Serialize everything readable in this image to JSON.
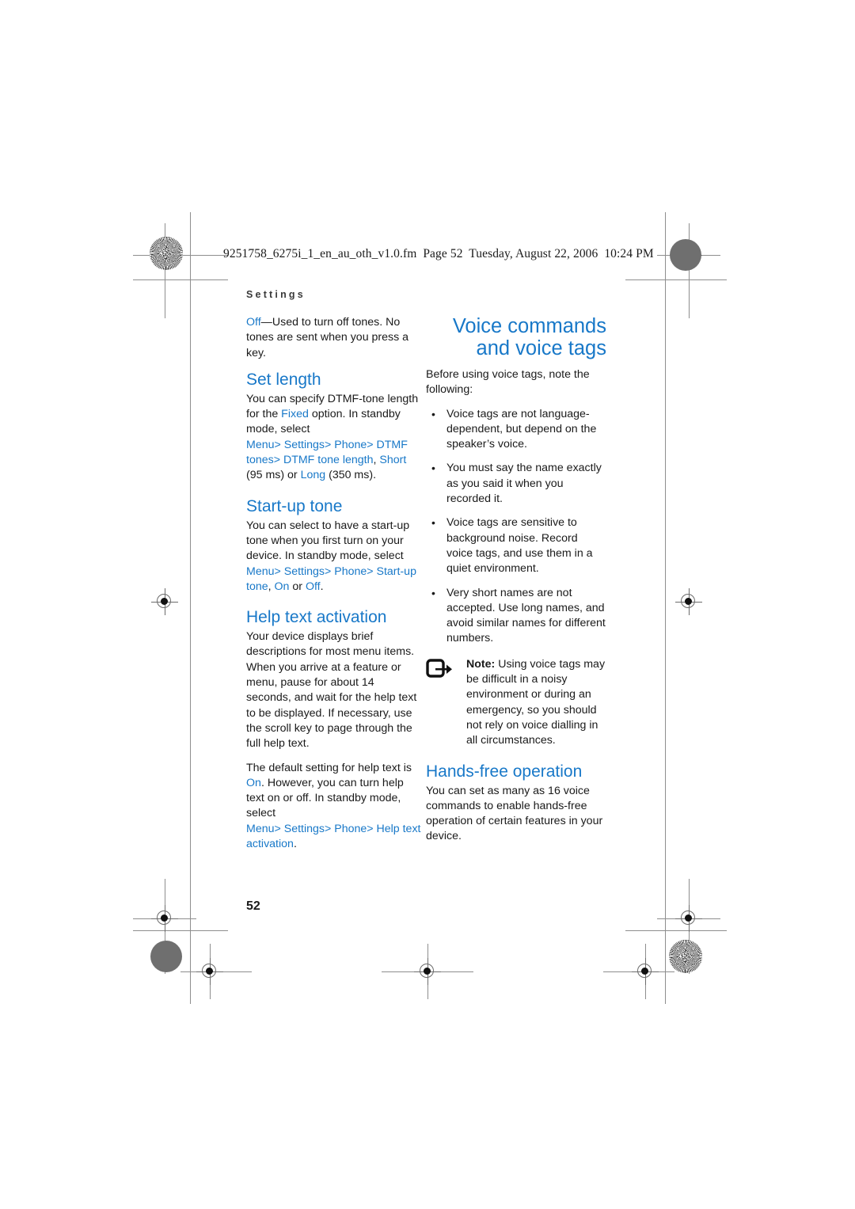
{
  "page": {
    "file_stamp": "9251758_6275i_1_en_au_oth_v1.0.fm  Page 52  Tuesday, August 22, 2006  10:24 PM",
    "running_head": "Settings",
    "page_number": "52",
    "accent_blue": "#1878c8",
    "text_color": "#1a1a1a"
  },
  "left_column": {
    "intro": {
      "term": "Off",
      "text": "—Used to turn off tones. No tones are sent when you press a key."
    },
    "set_length": {
      "heading": "Set length",
      "p1_a": "You can specify DTMF-tone length for the ",
      "p1_fixed": "Fixed",
      "p1_b": " option. In standby mode, select ",
      "path": [
        "Menu",
        "Settings",
        "Phone",
        "DTMF tones",
        "DTMF tone length"
      ],
      "p1_c": ", ",
      "opt_short": "Short",
      "p1_d": " (95 ms) or ",
      "opt_long": "Long",
      "p1_e": " (350 ms)."
    },
    "start_up_tone": {
      "heading": "Start-up tone",
      "p1_a": "You can select to have a start-up tone when you first turn on your device. In standby mode, select ",
      "path": [
        "Menu",
        "Settings",
        "Phone",
        "Start-up tone"
      ],
      "p1_b": ", ",
      "opt_on": "On",
      "p1_c": " or ",
      "opt_off": "Off",
      "p1_d": "."
    },
    "help_text": {
      "heading": "Help text activation",
      "p1": "Your device displays brief descriptions for most menu items. When you arrive at a feature or menu, pause for about 14 seconds, and wait for the help text to be displayed. If necessary, use the scroll key to page through the full help text.",
      "p2_a": "The default setting for help text is ",
      "p2_on": "On",
      "p2_b": ". However, you can turn help text on or off. In standby mode, select ",
      "path": [
        "Menu",
        "Settings",
        "Phone",
        "Help text activation"
      ],
      "p2_c": "."
    }
  },
  "right_column": {
    "chapter_title": "Voice commands and voice tags",
    "intro": "Before using voice tags, note the following:",
    "bullets": [
      "Voice tags are not language-dependent, but depend on the speaker’s voice.",
      "You must say the name exactly as you said it when you recorded it.",
      "Voice tags are sensitive to background noise. Record voice tags, and use them in a quiet environment.",
      "Very short names are not accepted. Use long names, and avoid similar names for different numbers."
    ],
    "note": {
      "label": "Note:",
      "text": " Using voice tags may be difficult in a noisy environment or during an emergency, so you should not rely on voice dialling in all circumstances."
    },
    "hands_free": {
      "heading": "Hands-free operation",
      "p1": "You can set as many as 16 voice commands to enable hands-free operation of certain features in your device."
    }
  }
}
